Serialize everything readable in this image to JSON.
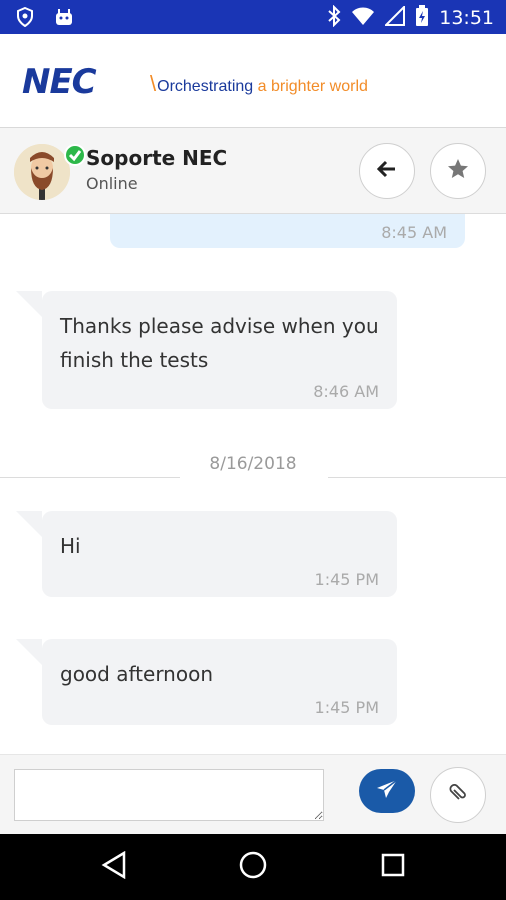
{
  "status_bar": {
    "time": "13:51",
    "icons": [
      "shield-icon",
      "android-icon",
      "bluetooth-icon",
      "wifi-icon",
      "signal-icon",
      "battery-icon"
    ]
  },
  "brand": {
    "logo": "NEC",
    "tagline_part1": "Orchestrating",
    "tagline_part2": "a brighter world",
    "brand_blue": "#1a3a9c",
    "brand_orange": "#f28c28"
  },
  "contact": {
    "name": "Soporte NEC",
    "status": "Online",
    "back_icon": "arrow-left-icon",
    "favorite_icon": "star-icon"
  },
  "messages": {
    "sent_partial": {
      "time": "8:45 AM"
    },
    "received": [
      {
        "text": "Thanks please advise when you finish the tests",
        "time": "8:46 AM"
      },
      {
        "text": "Hi",
        "time": "1:45 PM"
      },
      {
        "text": "good afternoon",
        "time": "1:45 PM"
      }
    ],
    "date_separator": "8/16/2018"
  },
  "composer": {
    "input_value": "",
    "input_placeholder": "",
    "send_icon": "paper-plane-icon",
    "attach_icon": "paperclip-icon",
    "send_color": "#1a5aa8"
  },
  "navbar": {
    "icons": [
      "triangle-back-icon",
      "circle-home-icon",
      "square-recents-icon"
    ]
  }
}
